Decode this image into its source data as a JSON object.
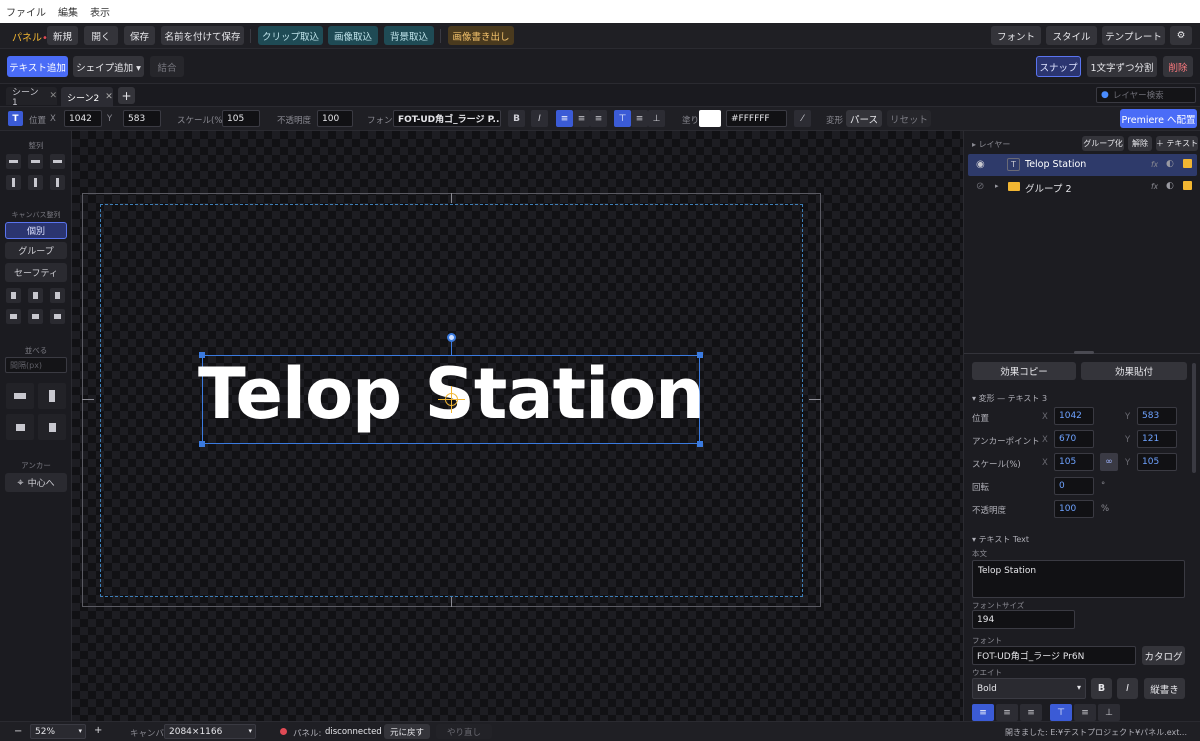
{
  "menu": [
    "ファイル",
    "編集",
    "表示"
  ],
  "toolbar": {
    "panel_label": "パネル",
    "panel_dot": "•",
    "new": "新規",
    "open": "開く",
    "save": "保存",
    "save_as": "名前を付けて保存",
    "clip_import": "クリップ取込",
    "image_import": "画像取込",
    "bg_import": "背景取込",
    "image_export": "画像書き出し",
    "font": "フォント",
    "style": "スタイル",
    "template": "テンプレート",
    "settings_icon": "⚙"
  },
  "toolbar2": {
    "add_text": "テキスト追加",
    "add_shape": "シェイプ追加 ▾",
    "combine": "結合",
    "snap": "スナップ",
    "split_chars": "1文字ずつ分割",
    "delete": "削除"
  },
  "tabs": [
    {
      "label": "シーン1",
      "close": "✕"
    },
    {
      "label": "シーン2",
      "close": "✕"
    }
  ],
  "tab_add": "+",
  "layer_search_placeholder": "レイヤー検索",
  "props": {
    "type_icon": "T",
    "pos_label": "位置",
    "x_label": "X",
    "x_value": "1042",
    "y_label": "Y",
    "y_value": "583",
    "scale_label": "スケール(%)",
    "scale_value": "105",
    "opacity_label": "不透明度",
    "opacity_value": "100",
    "font_label": "フォント",
    "font_value": "FOT-UD角ゴ_ラージ P...",
    "bold": "B",
    "italic": "I",
    "fill_label": "塗り",
    "fill_hex": "#FFFFFF",
    "transform_label": "変形",
    "perspective": "パース",
    "reset": "リセット",
    "premiere_button": "Premiere へ配置"
  },
  "left_panel": {
    "align_title": "整列",
    "canvas_align_title": "キャンバス整列",
    "individual": "個別",
    "group": "グループ",
    "safety": "セーフティ",
    "arrange_title": "並べる",
    "spacing_placeholder": "間隔(px)",
    "anchor_title": "アンカー",
    "center_button": "中心へ"
  },
  "canvas": {
    "text": "Telop Station",
    "text_color": "#FFFFFF",
    "selection_color": "#3b7be0"
  },
  "layers": {
    "title": "レイヤー",
    "group_button": "グループ化",
    "ungroup_button": "解除",
    "add_text_button": "＋ テキスト",
    "items": [
      {
        "name": "Telop Station",
        "type_icon": "T",
        "fx": "fx",
        "selected": true
      },
      {
        "name": "グループ 2",
        "fx": "fx",
        "selected": false
      }
    ]
  },
  "effects": {
    "copy": "効果コピー",
    "paste": "効果貼付"
  },
  "transform": {
    "section_title": "変形 — テキスト 3",
    "position_label": "位置",
    "x": "X",
    "y": "Y",
    "pos_x": "1042",
    "pos_y": "583",
    "anchor_label": "アンカーポイント",
    "anchor_x": "670",
    "anchor_y": "121",
    "scale_label": "スケール(%)",
    "scale_x": "105",
    "scale_y": "105",
    "rotation_label": "回転",
    "rotation_value": "0",
    "rotation_unit": "°",
    "opacity_label": "不透明度",
    "opacity_value": "100",
    "opacity_unit": "%"
  },
  "text_section": {
    "section_title": "テキスト Text",
    "body_label": "本文",
    "body_value": "Telop Station",
    "font_size_label": "フォントサイズ",
    "font_size_value": "194",
    "font_label": "フォント",
    "font_value": "FOT-UD角ゴ_ラージ Pr6N",
    "catalog_button": "カタログ",
    "weight_label": "ウエイト",
    "weight_value": "Bold",
    "bold": "B",
    "italic": "I",
    "vertical_button": "縦書き"
  },
  "status": {
    "zoom_minus": "−",
    "zoom_value": "52%",
    "zoom_plus": "+",
    "canvas_label": "キャンバス",
    "canvas_size": "2084×1166",
    "panel_label": "パネル:",
    "panel_status": "disconnected",
    "undo": "元に戻す",
    "redo": "やり直し",
    "message": "開きました: E:¥テストプロジェクト¥パネル.ext..."
  },
  "colors": {
    "accent": "#4a6cf7",
    "danger": "#e0565b",
    "status_dot": "#e04a55",
    "folder": "#f2b632",
    "lock": "#f2b632"
  }
}
